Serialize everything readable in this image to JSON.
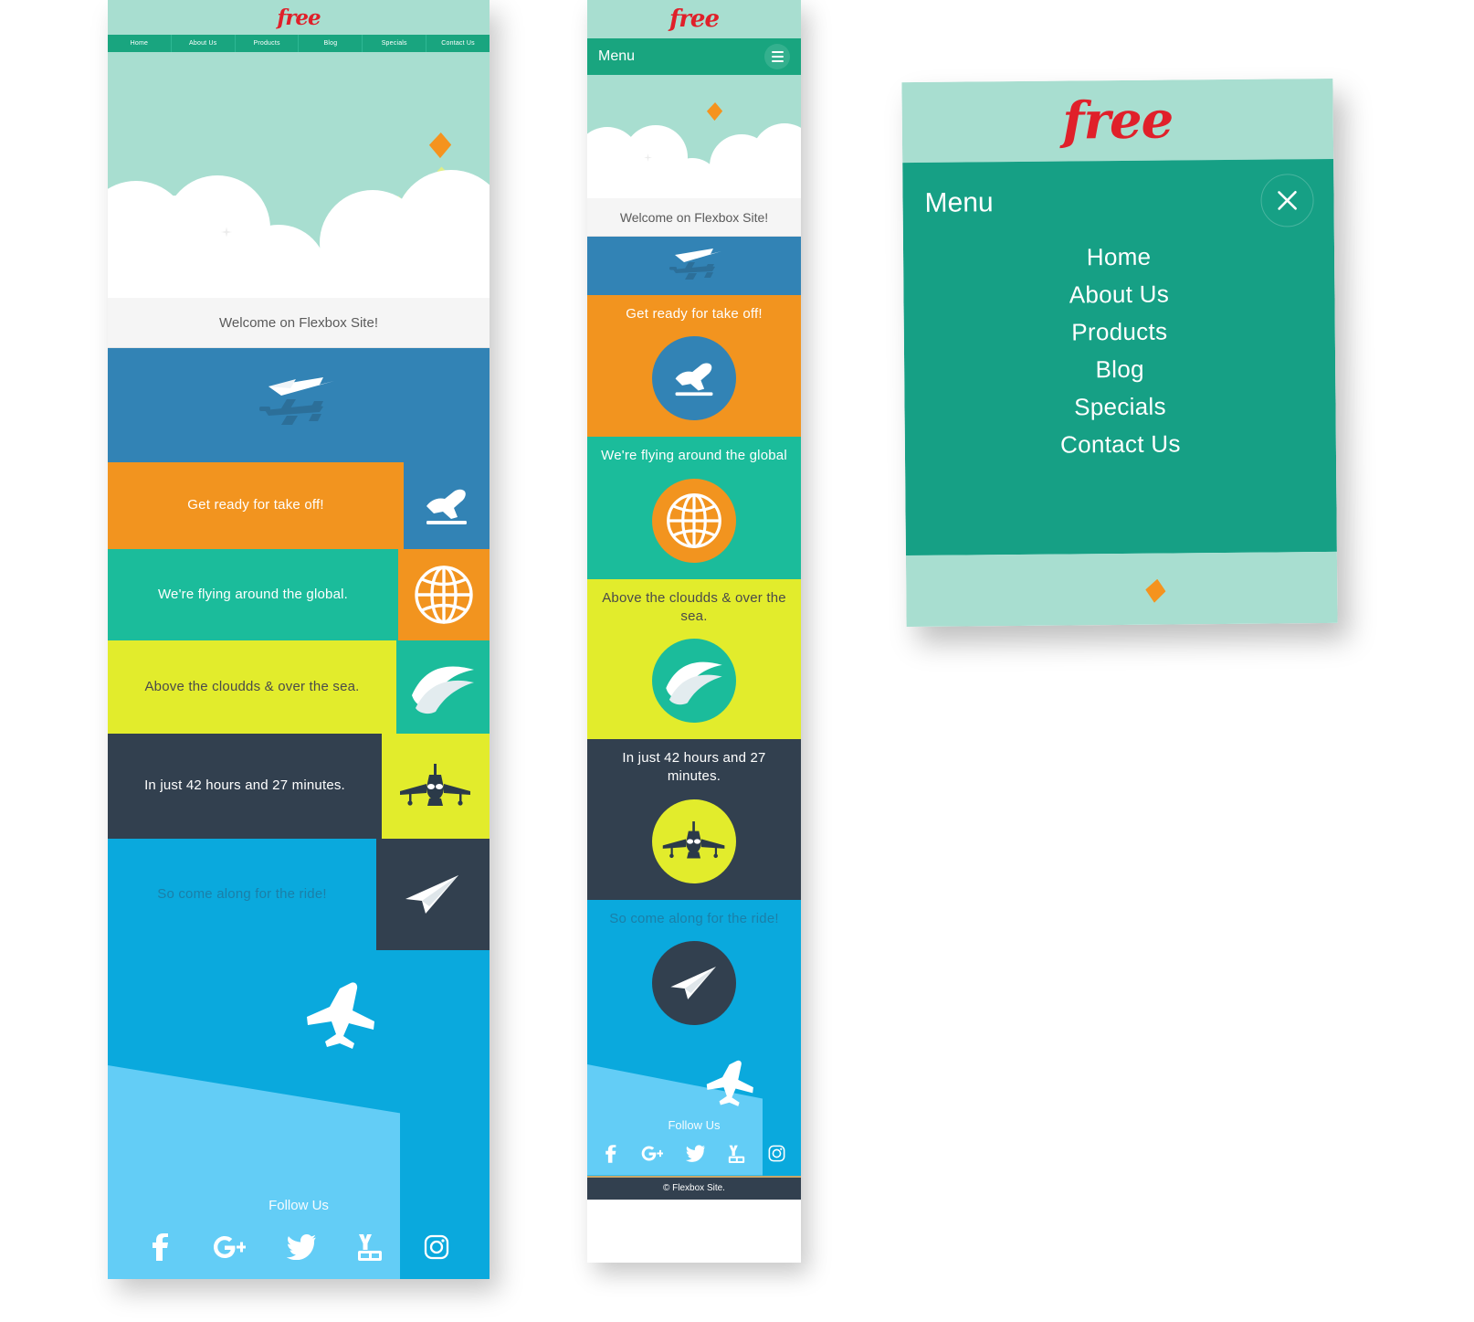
{
  "brand": {
    "logo_text": "free",
    "logo_color": "#e0202a"
  },
  "desktop": {
    "nav": [
      {
        "label": "Home"
      },
      {
        "label": "About Us"
      },
      {
        "label": "Products"
      },
      {
        "label": "Blog"
      },
      {
        "label": "Specials"
      },
      {
        "label": "Contact Us"
      }
    ],
    "welcome": "Welcome on Flexbox Site!",
    "sections": [
      {
        "text": "Get ready for take off!",
        "bg": "#f2941f",
        "icon_bg": "#3283b5",
        "icon": "plane-takeoff-icon",
        "text_color": "#ffffff"
      },
      {
        "text": "We're flying around the global.",
        "bg": "#1bbc9b",
        "icon_bg": "#f2941f",
        "icon": "globe-icon",
        "text_color": "#ffffff"
      },
      {
        "text": "Above the cloudds & over the sea.",
        "bg": "#e2ec2c",
        "icon_bg": "#1bbc9b",
        "icon": "wave-icon",
        "text_color": "#4a4a4a"
      },
      {
        "text": "In just 42 hours and 27 minutes.",
        "bg": "#32404f",
        "icon_bg": "#e2ec2c",
        "icon": "airplane-front-icon",
        "text_color": "#ffffff"
      },
      {
        "text": "So come along for the ride!",
        "bg": "#0aa9dd",
        "icon_bg": "#32404f",
        "icon": "paper-plane-icon",
        "text_color": "#1b7fa8"
      }
    ],
    "follow_label": "Follow Us",
    "social": [
      {
        "name": "facebook-icon"
      },
      {
        "name": "google-plus-icon"
      },
      {
        "name": "twitter-icon"
      },
      {
        "name": "youtube-icon"
      },
      {
        "name": "instagram-icon"
      }
    ]
  },
  "mobile": {
    "menu_label": "Menu",
    "welcome": "Welcome on Flexbox Site!",
    "sections": [
      {
        "text": "Get ready for take off!",
        "bg": "#f2941f",
        "icon_bg": "#3283b5",
        "icon": "plane-takeoff-icon",
        "text_color": "#ffffff"
      },
      {
        "text": "We're flying around the global",
        "bg": "#1bbc9b",
        "icon_bg": "#f2941f",
        "icon": "globe-icon",
        "text_color": "#ffffff"
      },
      {
        "text": "Above the cloudds & over the sea.",
        "bg": "#e2ec2c",
        "icon_bg": "#1bbc9b",
        "icon": "wave-icon",
        "text_color": "#4a4a4a"
      },
      {
        "text": "In just 42 hours and 27 minutes.",
        "bg": "#32404f",
        "icon_bg": "#e2ec2c",
        "icon": "airplane-front-icon",
        "text_color": "#ffffff"
      },
      {
        "text": "So come along for the ride!",
        "bg": "#0aa9dd",
        "icon_bg": "#32404f",
        "icon": "paper-plane-icon",
        "text_color": "#1b7fa8"
      }
    ],
    "follow_label": "Follow Us",
    "social": [
      {
        "name": "facebook-icon"
      },
      {
        "name": "google-plus-icon"
      },
      {
        "name": "twitter-icon"
      },
      {
        "name": "youtube-icon"
      },
      {
        "name": "instagram-icon"
      }
    ],
    "copyright": "© Flexbox Site."
  },
  "menu_overlay": {
    "title": "Menu",
    "close_icon": "close-icon",
    "items": [
      {
        "label": "Home"
      },
      {
        "label": "About Us"
      },
      {
        "label": "Products"
      },
      {
        "label": "Blog"
      },
      {
        "label": "Specials"
      },
      {
        "label": "Contact Us"
      }
    ]
  },
  "colors": {
    "mint": "#a8ded0",
    "green": "#19a57f",
    "teal": "#1bbc9b",
    "orange": "#f2941f",
    "yellow": "#e2ec2c",
    "navy": "#32404f",
    "blue": "#3283b5",
    "sky": "#0aa9dd",
    "sea": "#63cdf6",
    "red": "#e0202a"
  }
}
